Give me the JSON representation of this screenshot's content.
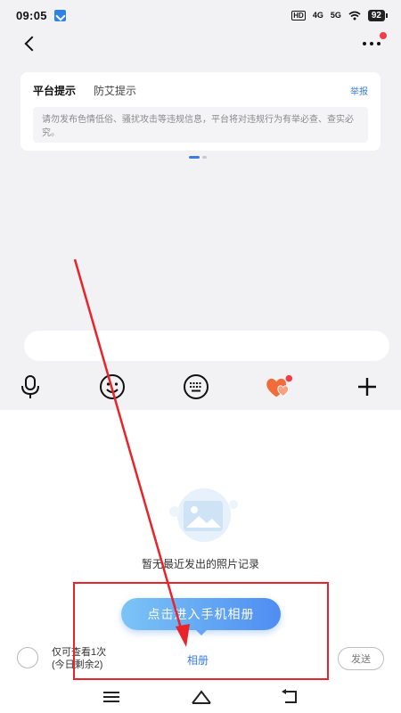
{
  "status_bar": {
    "time": "09:05",
    "hd_label": "HD",
    "network_4g": "4G",
    "network_5g": "5G",
    "battery": "92"
  },
  "header": {
    "back_icon": "chevron-left-icon",
    "more_icon": "more-horizontal-icon",
    "notification_dot_color": "#f03c4b"
  },
  "tips_card": {
    "tabs": [
      {
        "label": "平台提示",
        "active": true
      },
      {
        "label": "防艾提示",
        "active": false
      }
    ],
    "report_label": "举报",
    "message": "请勿发布色情低俗、骚扰攻击等违规信息，平台将对违规行为有举必查、查实必究。"
  },
  "toolbar": {
    "icons": [
      "microphone-icon",
      "emoji-icon",
      "keyboard-icon",
      "heart-gift-icon",
      "plus-icon"
    ]
  },
  "album_panel": {
    "empty_icon": "photo-placeholder-icon",
    "empty_text": "暂无最近发出的照片记录",
    "open_album_button": "点击进入手机相册",
    "view_once_line1": "仅可查看1次",
    "view_once_line2": "(今日剩余2)",
    "album_tab_label": "相册",
    "send_button": "发送"
  },
  "nav_bar": {
    "icons": [
      "menu-icon",
      "home-icon",
      "back-icon"
    ]
  },
  "colors": {
    "accent": "#3b7de8",
    "annotation_red": "#e8232a",
    "gift_orange": "#f26b3a"
  }
}
